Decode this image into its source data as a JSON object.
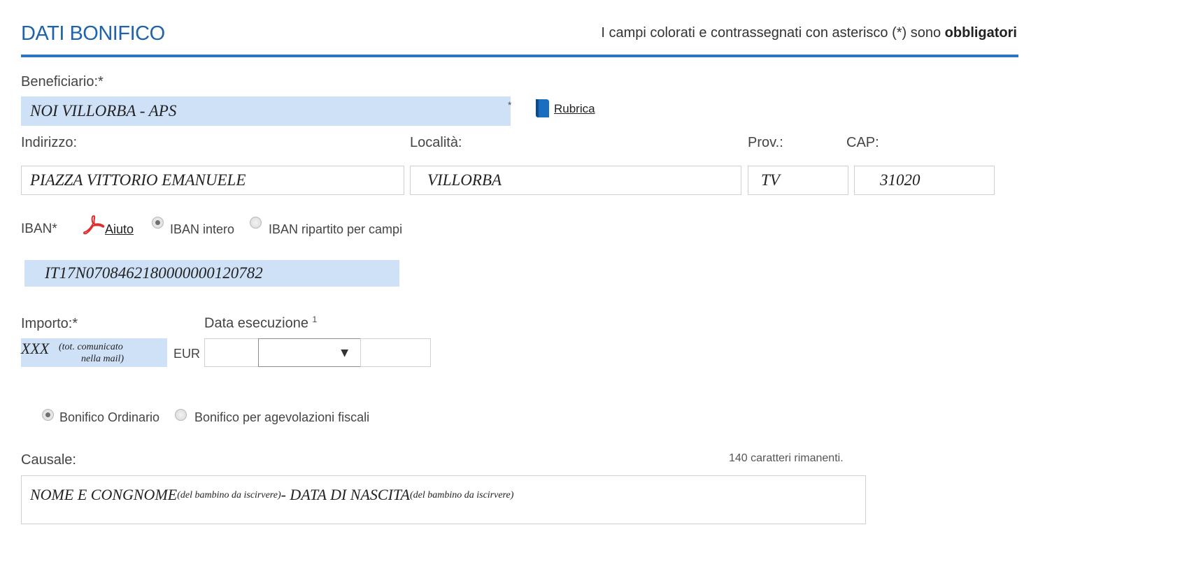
{
  "header": {
    "title": "DATI BONIFICO",
    "note_prefix": "I campi colorati e contrassegnati con asterisco (*) sono ",
    "note_bold": "obbligatori"
  },
  "beneficiario": {
    "label": "Beneficiario:*",
    "value": "NOI VILLORBA - APS",
    "marker": "*",
    "rubrica_label": "Rubrica",
    "rubrica_icon": "address-book-icon"
  },
  "address": {
    "indirizzo_label": "Indirizzo:",
    "indirizzo_value": "PIAZZA VITTORIO EMANUELE",
    "localita_label": "Località:",
    "localita_value": "VILLORBA",
    "prov_label": "Prov.:",
    "prov_value": "TV",
    "cap_label": "CAP:",
    "cap_value": "31020"
  },
  "iban": {
    "label": "IBAN*",
    "help_label": "Aiuto",
    "help_icon": "pdf-icon",
    "option_intero": "IBAN intero",
    "option_ripartito": "IBAN ripartito per campi",
    "selected": "intero",
    "value": "IT17N0708462180000000120782"
  },
  "importo": {
    "label": "Importo:*",
    "value": "XXX",
    "value_note_line1": "(tot. comunicato",
    "value_note_line2": "nella mail)",
    "currency": "EUR"
  },
  "data_esecuzione": {
    "label": "Data esecuzione",
    "footnote": "1",
    "day": "",
    "month": "",
    "year": "",
    "dropdown_arrow": "▼"
  },
  "tipo_bonifico": {
    "option_ordinario": "Bonifico Ordinario",
    "option_agevolazioni": "Bonifico per agevolazioni fiscali",
    "selected": "ordinario"
  },
  "causale": {
    "label": "Causale:",
    "remaining": "140 caratteri rimanenti.",
    "part1": "NOME E CONGNOME",
    "part2": " (del  bambino da iscirvere)",
    "part3": "  - DATA DI NASCITA",
    "part4": " (del  bambino da iscirvere)"
  },
  "colors": {
    "accent": "#1f63ad",
    "rule": "#2f73c8",
    "required_field": "#cfe1f7"
  }
}
